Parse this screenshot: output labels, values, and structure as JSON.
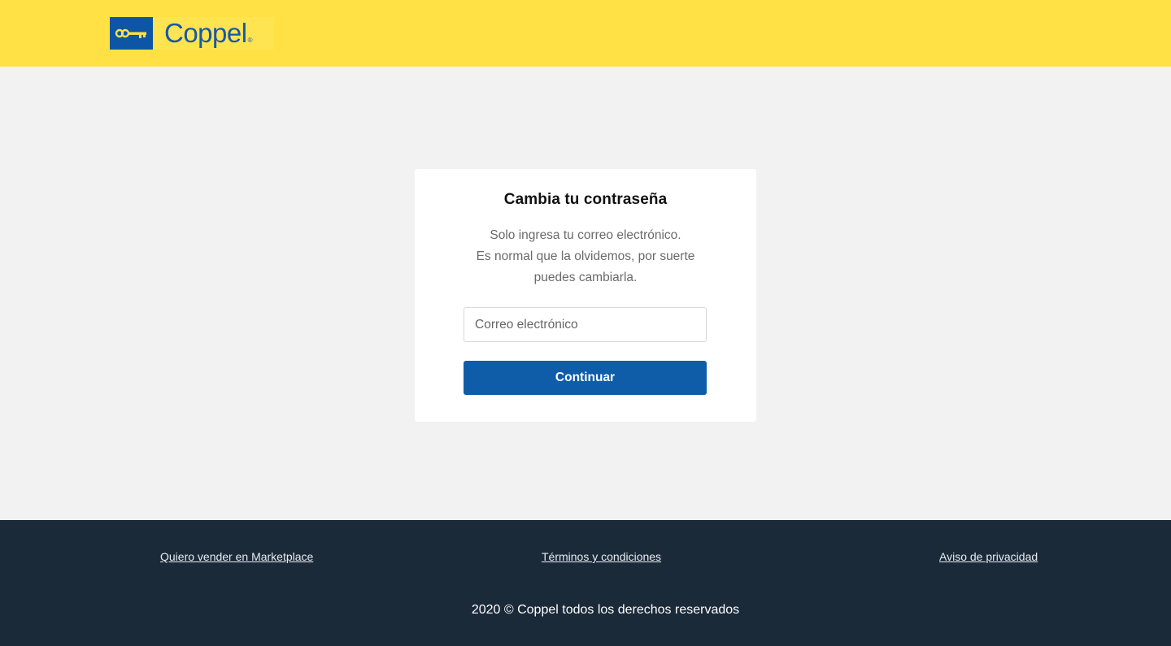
{
  "header": {
    "logo_text": "Coppel",
    "logo_mark": "®",
    "logo_icon": "key-icon",
    "background_color": "#ffe145",
    "brand_blue": "#0d56a6"
  },
  "card": {
    "title": "Cambia tu contraseña",
    "description_lines": [
      "Solo ingresa tu correo electrónico.",
      "Es normal que la olvidemos, por suerte",
      "puedes cambiarla."
    ],
    "email_placeholder": "Correo electrónico",
    "email_value": "",
    "continue_label": "Continuar",
    "button_color": "#0f5da9"
  },
  "footer": {
    "links": {
      "marketplace": "Quiero vender en Marketplace",
      "terms": "Términos y condiciones",
      "privacy": "Aviso de privacidad"
    },
    "copyright": "2020 © Coppel todos los derechos reservados",
    "background_color": "#1b2a39"
  }
}
